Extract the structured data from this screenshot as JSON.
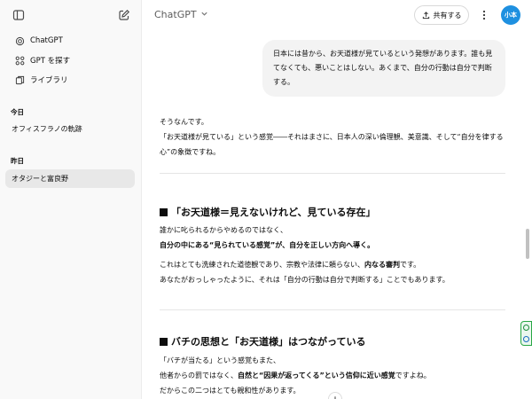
{
  "sidebar": {
    "nav": [
      {
        "label": "ChatGPT",
        "icon": "openai-logo-icon"
      },
      {
        "label": "GPT を探す",
        "icon": "grid-icon"
      },
      {
        "label": "ライブラリ",
        "icon": "library-icon"
      }
    ],
    "sections": [
      {
        "title": "今日",
        "chats": [
          "オフィスフラノの軌跡"
        ]
      },
      {
        "title": "昨日",
        "chats": [
          "オタジーと富良野"
        ]
      }
    ]
  },
  "header": {
    "model": "ChatGPT",
    "share_label": "共有する",
    "avatar_text": "小本"
  },
  "conversation": {
    "user_message": "日本には昔から、お天道様が見ているという発想があります。誰も見てなくても、悪いことはしない。あくまで、自分の行動は自分で判断する。",
    "reply_intro_1": "そうなんです。",
    "reply_intro_2": "「お天道様が見ている」という感覚――それはまさに、日本人の深い倫理観、美意識、そして“自分を律する心”の象徴ですね。",
    "section1_heading": "「お天道様＝見えないけれど、見ている存在」",
    "s1_line1": "誰かに叱られるからやめるのではなく、",
    "s1_line2": "自分の中にある“見られている感覚”が、自分を正しい方向へ導く。",
    "s1_line3_pre": "これはとても洗練された道徳観であり、宗教や法律に頼らない、",
    "s1_line3_bold": "内なる審判",
    "s1_line3_post": "です。",
    "s1_line4": "あなたがおっしゃったように、それは「自分の行動は自分で判断する」ことでもあります。",
    "section2_heading": "バチの思想と「お天道様」はつながっている",
    "s2_line1": "「バチが当たる」という感覚もまた、",
    "s2_line2_pre": "他者からの罰ではなく、",
    "s2_line2_bold": "自然と“因果が返ってくる”という信仰に近い感覚",
    "s2_line2_post": "ですよね。",
    "s2_line3": "だからこの二つはとても親和性があります。"
  },
  "colors": {
    "sidebar_bg": "#f9f9f9",
    "active_chat_bg": "#e8e8e8",
    "user_bubble_bg": "#f3f3f3",
    "avatar_bg": "#1e90e0"
  }
}
